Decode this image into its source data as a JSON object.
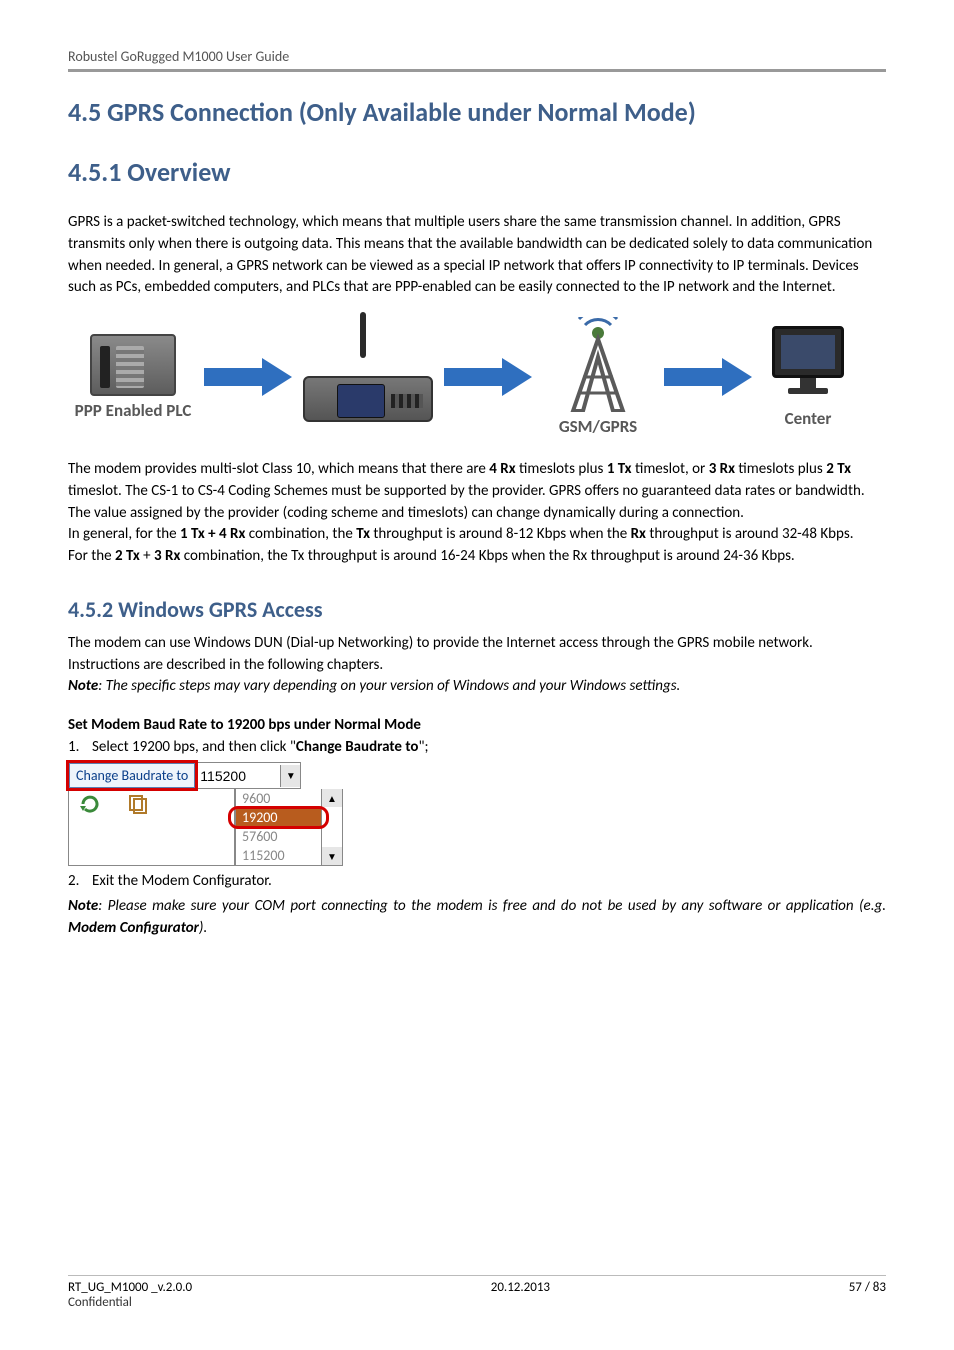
{
  "header": {
    "doc_title": "Robustel GoRugged M1000 User Guide"
  },
  "h2": "4.5    GPRS Connection (Only Available under Normal Mode)",
  "sec451": {
    "title": "4.5.1  Overview",
    "p1": "GPRS is a packet-switched technology, which means that multiple users share the same transmission channel. In addition, GPRS transmits only when there is outgoing data. This means that the available bandwidth can be dedicated solely to data communication when needed. In general, a GPRS network can be viewed as a special IP network that offers IP connectivity to IP terminals. Devices such as PCs, embedded computers, and PLCs that are PPP-enabled can be easily connected to the IP network and the Internet.",
    "diagram": {
      "plc_label": "PPP Enabled PLC",
      "gsm_label": "GSM/GPRS",
      "center_label": "Center"
    },
    "p2a": "The modem provides multi-slot Class 10, which means that there are ",
    "p2_4rx": "4 Rx",
    "p2b": " timeslots plus ",
    "p2_1tx": "1 Tx",
    "p2c": " timeslot, or ",
    "p2_3rx": "3 Rx",
    "p2d": " timeslots plus ",
    "p2_2tx": "2 Tx",
    "p2e": " timeslot. The CS-1 to CS-4 Coding Schemes must be supported by the provider. GPRS offers no guaranteed data rates or bandwidth. The value assigned by the provider (coding scheme and timeslots) can change dynamically during a connection.",
    "p3a": "In general, for the ",
    "p3_combo": "1 Tx + 4 Rx",
    "p3b": " combination, the ",
    "p3_tx": "Tx",
    "p3c": " throughput is around 8-12 Kbps when the ",
    "p3_rx": "Rx",
    "p3d": " throughput is around 32-48 Kbps.",
    "p4a": "For the ",
    "p4_2tx": "2 Tx",
    "p4b": " + ",
    "p4_3rx": "3 Rx",
    "p4c": " combination, the Tx throughput is around 16-24 Kbps when the Rx throughput is around 24-36 Kbps."
  },
  "sec452": {
    "title": "4.5.2  Windows GPRS Access",
    "p1": "The modem can use Windows DUN (Dial-up Networking) to provide the Internet access through the GPRS mobile network. Instructions are described in the following chapters.",
    "note_label": "Note",
    "note_rest": ": The specific steps may vary depending on your version of Windows and your Windows settings.",
    "subhead": "Set Modem Baud Rate to 19200 bps under Normal Mode",
    "step1_num": "1.",
    "step1a": "Select 19200 bps, and then click \"",
    "step1_bold": "Change Baudrate to",
    "step1b": "\";",
    "widget": {
      "button_label": "Change Baudrate to",
      "selected_value": "115200",
      "options": [
        "9600",
        "19200",
        "57600",
        "115200"
      ]
    },
    "step2_num": "2.",
    "step2_text": "Exit the Modem Configurator.",
    "note2_label": "Note",
    "note2_a": ": Please make sure your COM port connecting to the modem is free and do not be used by any software or application (e.g. ",
    "note2_bold": "Modem Configurator",
    "note2_b": ")."
  },
  "footer": {
    "doc_id": "RT_UG_M1000 _v.2.0.0",
    "confidential": "Confidential",
    "date": "20.12.2013",
    "page": "57 / 83"
  }
}
